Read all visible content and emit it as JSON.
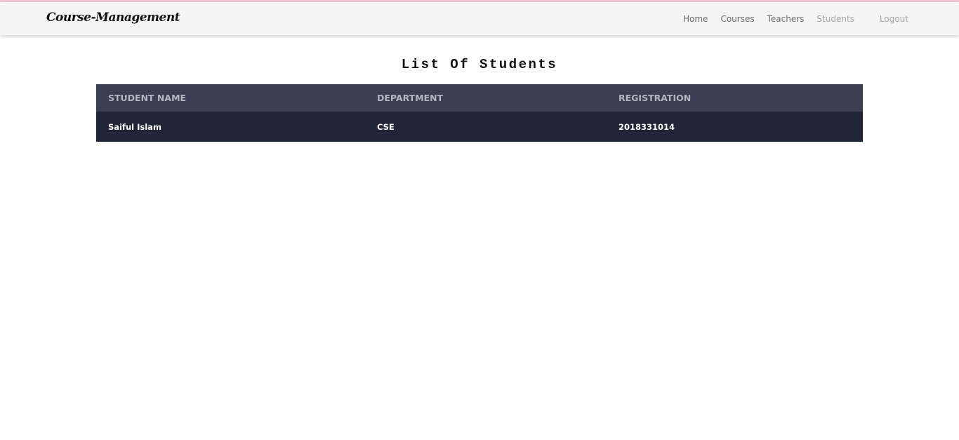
{
  "nav": {
    "brand": "Course-Management",
    "links": [
      "Home",
      "Courses",
      "Teachers",
      "Students"
    ],
    "active": "Students",
    "logout": "Logout"
  },
  "page": {
    "title": "List Of Students"
  },
  "table": {
    "headers": [
      "STUDENT NAME",
      "DEPARTMENT",
      "REGISTRATION"
    ],
    "rows": [
      [
        "Saiful Islam",
        "CSE",
        "2018331014"
      ]
    ]
  }
}
